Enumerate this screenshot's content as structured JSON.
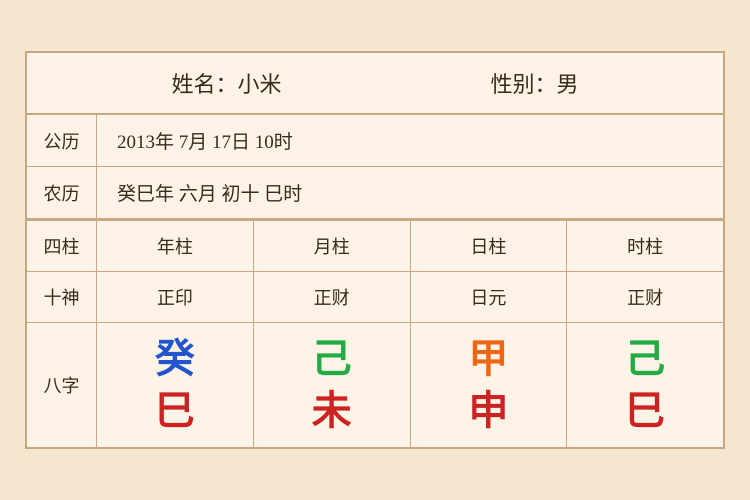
{
  "header": {
    "name_label": "姓名：小米",
    "gender_label": "性别：男"
  },
  "rows": {
    "gong_li_label": "公历",
    "gong_li_value": "2013年 7月 17日 10时",
    "nong_li_label": "农历",
    "nong_li_value": "癸巳年 六月 初十 巳时"
  },
  "table": {
    "col_labels": [
      "四柱",
      "年柱",
      "月柱",
      "日柱",
      "时柱"
    ],
    "shen_labels": [
      "十神",
      "正印",
      "正财",
      "日元",
      "正财"
    ],
    "bazi_label": "八字",
    "bazi_top": [
      {
        "char": "癸",
        "color": "#2255cc"
      },
      {
        "char": "己",
        "color": "#22aa44"
      },
      {
        "char": "甲",
        "color": "#ee6611"
      },
      {
        "char": "己",
        "color": "#22aa44"
      }
    ],
    "bazi_bottom": [
      {
        "char": "巳",
        "color": "#cc2222"
      },
      {
        "char": "未",
        "color": "#cc2222"
      },
      {
        "char": "申",
        "color": "#cc2222"
      },
      {
        "char": "巳",
        "color": "#cc2222"
      }
    ]
  }
}
